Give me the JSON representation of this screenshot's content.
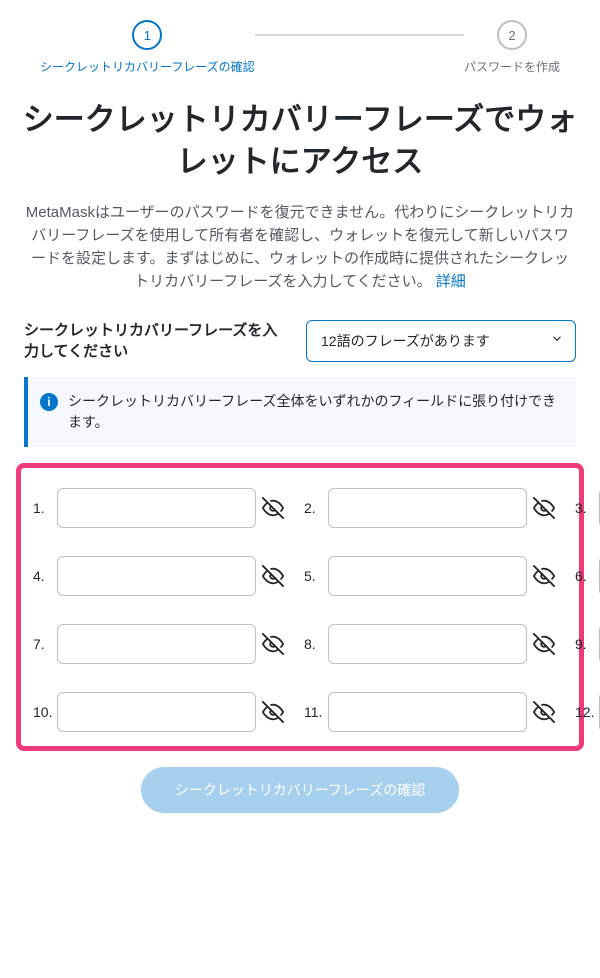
{
  "stepper": {
    "steps": [
      {
        "num": "1",
        "label": "シークレットリカバリーフレーズの確認"
      },
      {
        "num": "2",
        "label": "パスワードを作成"
      }
    ]
  },
  "heading": "シークレットリカバリーフレーズでウォレットにアクセス",
  "description_main": "MetaMaskはユーザーのパスワードを復元できません。代わりにシークレットリカバリーフレーズを使用して所有者を確認し、ウォレットを復元して新しいパスワードを設定します。まずはじめに、ウォレットの作成時に提供されたシークレットリカバリーフレーズを入力してください。",
  "description_link": "詳細",
  "section_label": "シークレットリカバリーフレーズを入力してください",
  "dropdown": {
    "selected": "12語のフレーズがあります"
  },
  "info_text": "シークレットリカバリーフレーズ全体をいずれかのフィールドに張り付けできます。",
  "phrase_inputs": [
    {
      "num": "1."
    },
    {
      "num": "2."
    },
    {
      "num": "3."
    },
    {
      "num": "4."
    },
    {
      "num": "5."
    },
    {
      "num": "6."
    },
    {
      "num": "7."
    },
    {
      "num": "8."
    },
    {
      "num": "9."
    },
    {
      "num": "10."
    },
    {
      "num": "11."
    },
    {
      "num": "12."
    }
  ],
  "confirm_button": "シークレットリカバリーフレーズの確認"
}
